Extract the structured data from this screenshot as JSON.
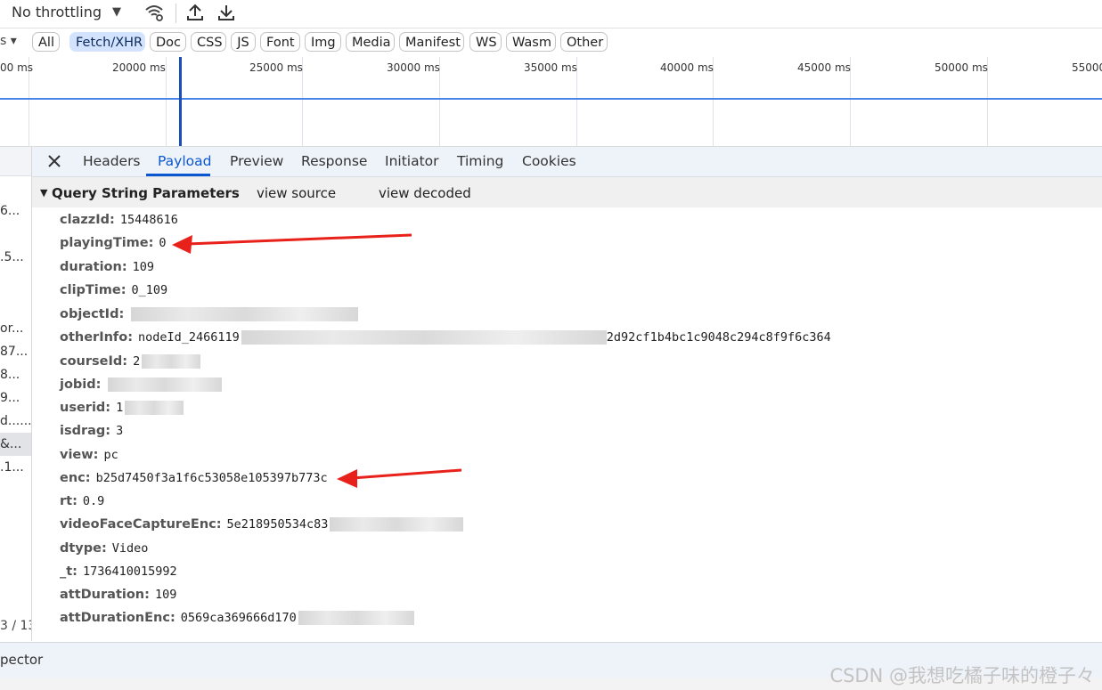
{
  "toolbar": {
    "throttling": "No throttling",
    "throttling_caret": "▼",
    "icons": [
      "wifi-settings-icon",
      "upload-icon",
      "download-icon"
    ]
  },
  "filters": {
    "cut_label": "s ▾",
    "chips": [
      "All",
      "Fetch/XHR",
      "Doc",
      "CSS",
      "JS",
      "Font",
      "Img",
      "Media",
      "Manifest",
      "WS",
      "Wasm",
      "Other"
    ],
    "active": "Fetch/XHR"
  },
  "timeline": {
    "ticks": [
      "00 ms",
      "20000 ms",
      "25000 ms",
      "30000 ms",
      "35000 ms",
      "40000 ms",
      "45000 ms",
      "50000 ms",
      "55000"
    ]
  },
  "request_list": {
    "rows": [
      "",
      "6...",
      "",
      ".5...",
      "",
      "or...",
      "87...",
      "8...",
      "9...",
      "d......",
      "&...",
      ".1..."
    ],
    "count": "3 / 13"
  },
  "details": {
    "tabs": [
      "Headers",
      "Payload",
      "Preview",
      "Response",
      "Initiator",
      "Timing",
      "Cookies"
    ],
    "active_tab": "Payload",
    "section_title": "Query String Parameters",
    "view_source": "view source",
    "view_decoded": "view decoded",
    "params": [
      {
        "key": "clazzId:",
        "value": "15448616"
      },
      {
        "key": "playingTime:",
        "value": "0"
      },
      {
        "key": "duration:",
        "value": "109"
      },
      {
        "key": "clipTime:",
        "value": "0_109"
      },
      {
        "key": "objectId:",
        "value": ""
      },
      {
        "key": "otherInfo:",
        "value": "nodeId_2466119",
        "value_tail": "2d92cf1b4bc1c9048c294c8f9f6c364"
      },
      {
        "key": "courseId:",
        "value": "2"
      },
      {
        "key": "jobid:",
        "value": ""
      },
      {
        "key": "userid:",
        "value": "1"
      },
      {
        "key": "isdrag:",
        "value": "3"
      },
      {
        "key": "view:",
        "value": "pc"
      },
      {
        "key": "enc:",
        "value": "b25d7450f3a1f6c53058e105397b773c"
      },
      {
        "key": "rt:",
        "value": "0.9"
      },
      {
        "key": "videoFaceCaptureEnc:",
        "value": "5e218950534c83"
      },
      {
        "key": "dtype:",
        "value": "Video"
      },
      {
        "key": "_t:",
        "value": "1736410015992"
      },
      {
        "key": "attDuration:",
        "value": "109"
      },
      {
        "key": "attDurationEnc:",
        "value": "0569ca369666d170"
      }
    ]
  },
  "drawer": {
    "label": "pector"
  },
  "watermark": "CSDN @我想吃橘子味的橙子々",
  "colors": {
    "accent": "#0b57d0",
    "chip_active": "#d3e3fd",
    "annotation_arrow": "#e8211a"
  }
}
